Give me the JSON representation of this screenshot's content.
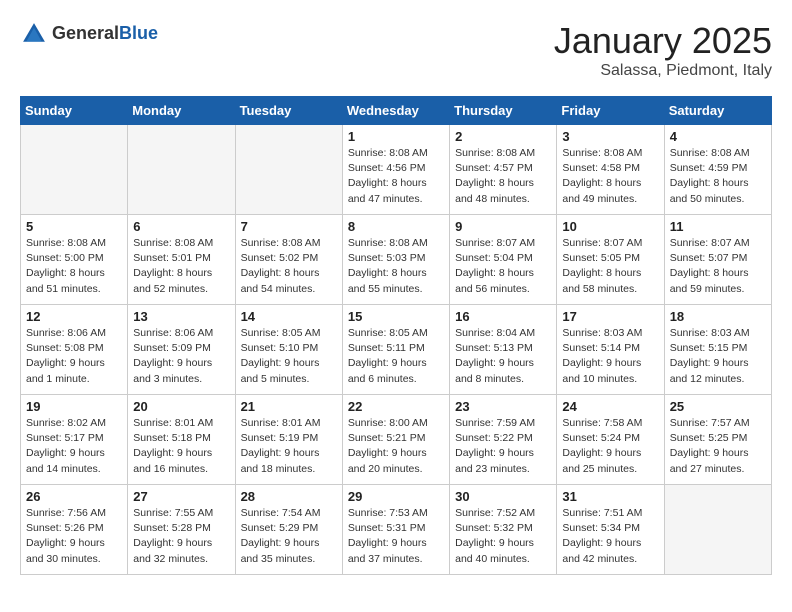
{
  "logo": {
    "general": "General",
    "blue": "Blue"
  },
  "header": {
    "month": "January 2025",
    "location": "Salassa, Piedmont, Italy"
  },
  "weekdays": [
    "Sunday",
    "Monday",
    "Tuesday",
    "Wednesday",
    "Thursday",
    "Friday",
    "Saturday"
  ],
  "weeks": [
    [
      {
        "day": "",
        "empty": true
      },
      {
        "day": "",
        "empty": true
      },
      {
        "day": "",
        "empty": true
      },
      {
        "day": "1",
        "sunrise": "8:08 AM",
        "sunset": "4:56 PM",
        "daylight": "8 hours and 47 minutes."
      },
      {
        "day": "2",
        "sunrise": "8:08 AM",
        "sunset": "4:57 PM",
        "daylight": "8 hours and 48 minutes."
      },
      {
        "day": "3",
        "sunrise": "8:08 AM",
        "sunset": "4:58 PM",
        "daylight": "8 hours and 49 minutes."
      },
      {
        "day": "4",
        "sunrise": "8:08 AM",
        "sunset": "4:59 PM",
        "daylight": "8 hours and 50 minutes."
      }
    ],
    [
      {
        "day": "5",
        "sunrise": "8:08 AM",
        "sunset": "5:00 PM",
        "daylight": "8 hours and 51 minutes."
      },
      {
        "day": "6",
        "sunrise": "8:08 AM",
        "sunset": "5:01 PM",
        "daylight": "8 hours and 52 minutes."
      },
      {
        "day": "7",
        "sunrise": "8:08 AM",
        "sunset": "5:02 PM",
        "daylight": "8 hours and 54 minutes."
      },
      {
        "day": "8",
        "sunrise": "8:08 AM",
        "sunset": "5:03 PM",
        "daylight": "8 hours and 55 minutes."
      },
      {
        "day": "9",
        "sunrise": "8:07 AM",
        "sunset": "5:04 PM",
        "daylight": "8 hours and 56 minutes."
      },
      {
        "day": "10",
        "sunrise": "8:07 AM",
        "sunset": "5:05 PM",
        "daylight": "8 hours and 58 minutes."
      },
      {
        "day": "11",
        "sunrise": "8:07 AM",
        "sunset": "5:07 PM",
        "daylight": "8 hours and 59 minutes."
      }
    ],
    [
      {
        "day": "12",
        "sunrise": "8:06 AM",
        "sunset": "5:08 PM",
        "daylight": "9 hours and 1 minute."
      },
      {
        "day": "13",
        "sunrise": "8:06 AM",
        "sunset": "5:09 PM",
        "daylight": "9 hours and 3 minutes."
      },
      {
        "day": "14",
        "sunrise": "8:05 AM",
        "sunset": "5:10 PM",
        "daylight": "9 hours and 5 minutes."
      },
      {
        "day": "15",
        "sunrise": "8:05 AM",
        "sunset": "5:11 PM",
        "daylight": "9 hours and 6 minutes."
      },
      {
        "day": "16",
        "sunrise": "8:04 AM",
        "sunset": "5:13 PM",
        "daylight": "9 hours and 8 minutes."
      },
      {
        "day": "17",
        "sunrise": "8:03 AM",
        "sunset": "5:14 PM",
        "daylight": "9 hours and 10 minutes."
      },
      {
        "day": "18",
        "sunrise": "8:03 AM",
        "sunset": "5:15 PM",
        "daylight": "9 hours and 12 minutes."
      }
    ],
    [
      {
        "day": "19",
        "sunrise": "8:02 AM",
        "sunset": "5:17 PM",
        "daylight": "9 hours and 14 minutes."
      },
      {
        "day": "20",
        "sunrise": "8:01 AM",
        "sunset": "5:18 PM",
        "daylight": "9 hours and 16 minutes."
      },
      {
        "day": "21",
        "sunrise": "8:01 AM",
        "sunset": "5:19 PM",
        "daylight": "9 hours and 18 minutes."
      },
      {
        "day": "22",
        "sunrise": "8:00 AM",
        "sunset": "5:21 PM",
        "daylight": "9 hours and 20 minutes."
      },
      {
        "day": "23",
        "sunrise": "7:59 AM",
        "sunset": "5:22 PM",
        "daylight": "9 hours and 23 minutes."
      },
      {
        "day": "24",
        "sunrise": "7:58 AM",
        "sunset": "5:24 PM",
        "daylight": "9 hours and 25 minutes."
      },
      {
        "day": "25",
        "sunrise": "7:57 AM",
        "sunset": "5:25 PM",
        "daylight": "9 hours and 27 minutes."
      }
    ],
    [
      {
        "day": "26",
        "sunrise": "7:56 AM",
        "sunset": "5:26 PM",
        "daylight": "9 hours and 30 minutes."
      },
      {
        "day": "27",
        "sunrise": "7:55 AM",
        "sunset": "5:28 PM",
        "daylight": "9 hours and 32 minutes."
      },
      {
        "day": "28",
        "sunrise": "7:54 AM",
        "sunset": "5:29 PM",
        "daylight": "9 hours and 35 minutes."
      },
      {
        "day": "29",
        "sunrise": "7:53 AM",
        "sunset": "5:31 PM",
        "daylight": "9 hours and 37 minutes."
      },
      {
        "day": "30",
        "sunrise": "7:52 AM",
        "sunset": "5:32 PM",
        "daylight": "9 hours and 40 minutes."
      },
      {
        "day": "31",
        "sunrise": "7:51 AM",
        "sunset": "5:34 PM",
        "daylight": "9 hours and 42 minutes."
      },
      {
        "day": "",
        "empty": true
      }
    ]
  ]
}
